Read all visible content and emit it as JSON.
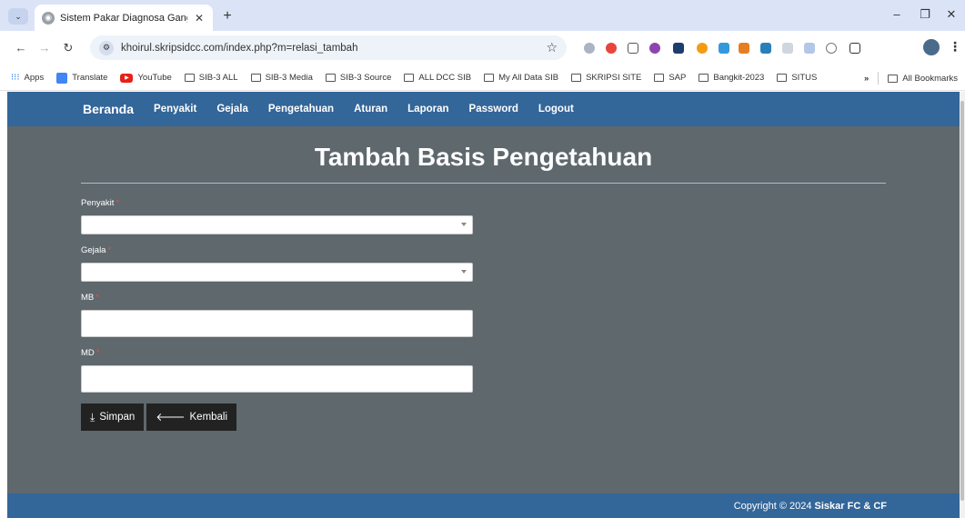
{
  "browser": {
    "tab_title": "Sistem Pakar Diagnosa Ganggu",
    "url": "khoirul.skripsidcc.com/index.php?m=relasi_tambah",
    "bookmarks": [
      {
        "label": "Apps",
        "icon": "apps-icon"
      },
      {
        "label": "Translate",
        "icon": "translate-icon"
      },
      {
        "label": "YouTube",
        "icon": "youtube-icon"
      },
      {
        "label": "SIB-3 ALL",
        "icon": "folder-icon"
      },
      {
        "label": "SIB-3 Media",
        "icon": "folder-icon"
      },
      {
        "label": "SIB-3 Source",
        "icon": "folder-icon"
      },
      {
        "label": "ALL DCC SIB",
        "icon": "folder-icon"
      },
      {
        "label": "My All Data SIB",
        "icon": "folder-icon"
      },
      {
        "label": "SKRIPSI SITE",
        "icon": "folder-icon"
      },
      {
        "label": "SAP",
        "icon": "folder-icon"
      },
      {
        "label": "Bangkit-2023",
        "icon": "folder-icon"
      },
      {
        "label": "SITUS",
        "icon": "folder-icon"
      }
    ],
    "all_bookmarks": "All Bookmarks",
    "overflow": "»"
  },
  "navbar": {
    "brand": "Beranda",
    "links": [
      "Penyakit",
      "Gejala",
      "Pengetahuan",
      "Aturan",
      "Laporan",
      "Password",
      "Logout"
    ]
  },
  "page": {
    "title": "Tambah Basis Pengetahuan"
  },
  "form": {
    "penyakit_label": "Penyakit",
    "gejala_label": "Gejala",
    "mb_label": "MB",
    "md_label": "MD",
    "required_mark": "*",
    "mb_value": "",
    "md_value": ""
  },
  "buttons": {
    "save_label": "Simpan",
    "back_label": "Kembali"
  },
  "footer": {
    "copyright": "Copyright © 2024 ",
    "brand": "Siskar FC & CF"
  },
  "colors": {
    "navbar": "#336699",
    "page_bg": "#5e686d",
    "button_bg": "#222222",
    "required": "#e05050"
  }
}
